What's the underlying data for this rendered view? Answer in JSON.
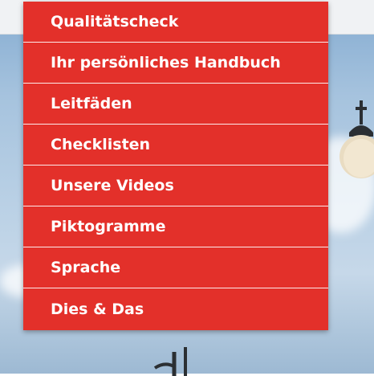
{
  "menu": {
    "items": [
      {
        "label": "Qualitätscheck"
      },
      {
        "label": "Ihr persönliches Handbuch"
      },
      {
        "label": "Leitfäden"
      },
      {
        "label": "Checklisten"
      },
      {
        "label": "Unsere Videos"
      },
      {
        "label": "Piktogramme"
      },
      {
        "label": "Sprache"
      },
      {
        "label": "Dies & Das"
      }
    ]
  },
  "colors": {
    "menu_background": "#e3302a",
    "menu_text": "#ffffff",
    "menu_divider": "#ffffff"
  },
  "background": {
    "icon": "street-lamp-icon"
  }
}
